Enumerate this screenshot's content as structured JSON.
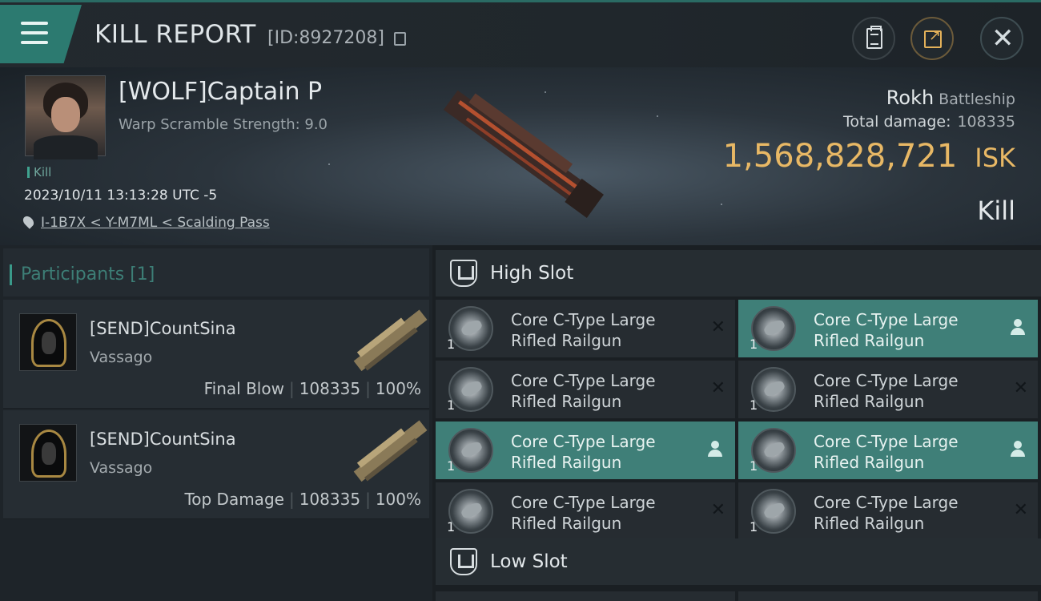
{
  "header": {
    "title": "KILL REPORT",
    "kill_id": "[ID:8927208]",
    "icons": [
      "menu-icon",
      "copy-icon",
      "clipboard-icon",
      "share-icon",
      "close-icon"
    ]
  },
  "victim": {
    "name": "[WOLF]Captain P",
    "warp_scramble": "Warp Scramble Strength: 9.0",
    "tag": "Kill",
    "timestamp": "2023/10/11 13:13:28 UTC -5",
    "location": "I-1B7X < Y-M7ML < Scalding Pass",
    "ship_name": "Rokh",
    "ship_class": "Battleship",
    "total_damage_label": "Total damage:",
    "total_damage": "108335",
    "isk_value": "1,568,828,721",
    "isk_unit": "ISK",
    "result": "Kill"
  },
  "participants": {
    "title": "Participants [1]",
    "rows": [
      {
        "name": "[SEND]CountSina",
        "ship": "Vassago",
        "role": "Final Blow",
        "damage": "108335",
        "percent": "100%"
      },
      {
        "name": "[SEND]CountSina",
        "ship": "Vassago",
        "role": "Top Damage",
        "damage": "108335",
        "percent": "100%"
      }
    ]
  },
  "fitting": {
    "high_slot_label": "High Slot",
    "low_slot_label": "Low Slot",
    "high_modules": [
      {
        "line1": "Core C-Type Large",
        "line2": "Rifled Railgun",
        "qty": "1",
        "state": "destroyed",
        "action_icon": "close-icon"
      },
      {
        "line1": "Core C-Type Large",
        "line2": "Rifled Railgun",
        "qty": "1",
        "state": "dropped",
        "action_icon": "person-icon"
      },
      {
        "line1": "Core C-Type Large",
        "line2": "Rifled Railgun",
        "qty": "1",
        "state": "destroyed",
        "action_icon": "close-icon"
      },
      {
        "line1": "Core C-Type Large",
        "line2": "Rifled Railgun",
        "qty": "1",
        "state": "destroyed",
        "action_icon": "close-icon"
      },
      {
        "line1": "Core C-Type Large",
        "line2": "Rifled Railgun",
        "qty": "1",
        "state": "dropped",
        "action_icon": "person-icon"
      },
      {
        "line1": "Core C-Type Large",
        "line2": "Rifled Railgun",
        "qty": "1",
        "state": "dropped",
        "action_icon": "person-icon"
      },
      {
        "line1": "Core C-Type Large",
        "line2": "Rifled Railgun",
        "qty": "1",
        "state": "destroyed",
        "action_icon": "close-icon"
      },
      {
        "line1": "Core C-Type Large",
        "line2": "Rifled Railgun",
        "qty": "1",
        "state": "destroyed",
        "action_icon": "close-icon"
      }
    ],
    "close_glyph": "✕"
  },
  "colors": {
    "accent": "#2c7a70",
    "isk_gold": "#e8b865",
    "dropped_bg": "#3f7f78",
    "panel_bg": "#262c31"
  }
}
